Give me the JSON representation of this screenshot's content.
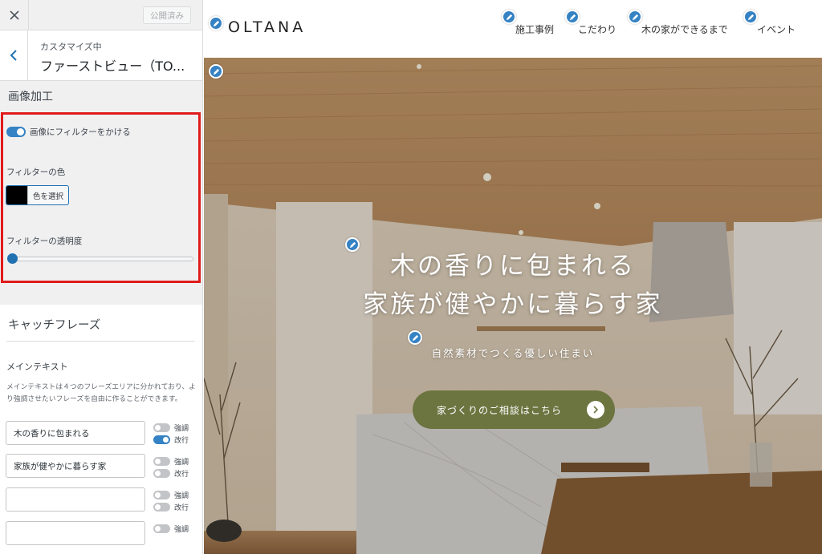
{
  "sidebar": {
    "publish_label": "公開済み",
    "subtitle": "カスタマイズ中",
    "title": "ファーストビュー（TO...",
    "image_section": {
      "title": "画像加工",
      "filter_toggle_label": "画像にフィルターをかける",
      "filter_toggle_on": true,
      "filter_color_label": "フィルターの色",
      "filter_color_value": "#000000",
      "color_button_label": "色を選択",
      "opacity_label": "フィルターの透明度",
      "opacity_value": 0.02
    },
    "catch_section": {
      "title": "キャッチフレーズ",
      "main_text_label": "メインテキスト",
      "description": "メインテキストは４つのフレーズエリアに分かれており、より強調させたいフレーズを自由に作ることができます。",
      "emphasis_label": "強調",
      "linebreak_label": "改行",
      "phrases": [
        {
          "value": "木の香りに包まれる",
          "emphasis": false,
          "linebreak": true
        },
        {
          "value": "家族が健やかに暮らす家",
          "emphasis": false,
          "linebreak": false
        },
        {
          "value": "",
          "emphasis": false,
          "linebreak": false
        },
        {
          "value": "",
          "emphasis": false
        }
      ]
    }
  },
  "preview": {
    "logo": "OLTANA",
    "nav": [
      "施工事例",
      "こだわり",
      "木の家ができるまで",
      "イベント"
    ],
    "hero": {
      "line1": "木の香りに包まれる",
      "line2": "家族が健やかに暮らす家",
      "subline": "自然素材でつくる優しい住まい",
      "cta": "家づくりのご相談はこちら"
    }
  },
  "colors": {
    "accent": "#3582c4",
    "highlight": "#e01b1b",
    "cta": "#6c7440"
  }
}
